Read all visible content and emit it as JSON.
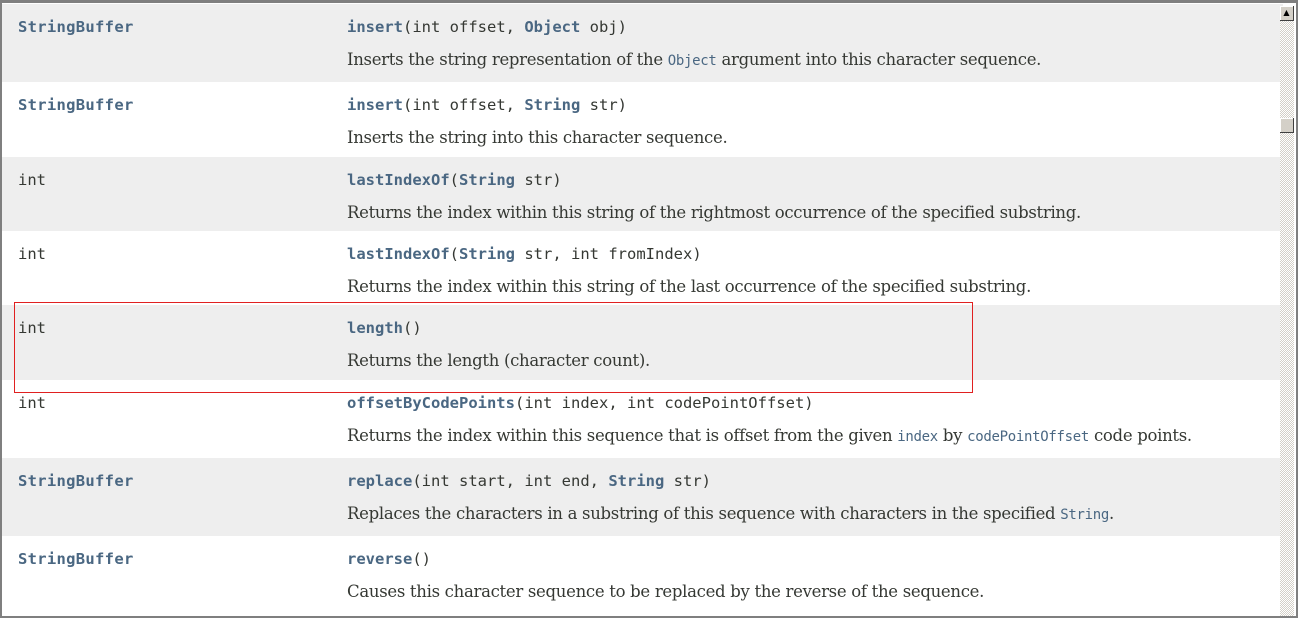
{
  "rows": [
    {
      "type": "StringBuffer",
      "type_link": true,
      "method": "insert",
      "params": [
        [
          "int",
          " offset, "
        ],
        [
          "Object",
          " obj"
        ]
      ],
      "desc": [
        [
          "text",
          "Inserts the string representation of the "
        ],
        [
          "code",
          "Object"
        ],
        [
          "text",
          " argument into this character sequence."
        ]
      ]
    },
    {
      "type": "StringBuffer",
      "type_link": true,
      "method": "insert",
      "params": [
        [
          "int",
          " offset, "
        ],
        [
          "String",
          " str"
        ]
      ],
      "desc": [
        [
          "text",
          "Inserts the string into this character sequence."
        ]
      ]
    },
    {
      "type": "int",
      "type_link": false,
      "method": "lastIndexOf",
      "params": [
        [
          "String",
          " str"
        ]
      ],
      "desc": [
        [
          "text",
          "Returns the index within this string of the rightmost occurrence of the specified substring."
        ]
      ]
    },
    {
      "type": "int",
      "type_link": false,
      "method": "lastIndexOf",
      "params": [
        [
          "String",
          " str, "
        ],
        [
          "int",
          " fromIndex"
        ]
      ],
      "desc": [
        [
          "text",
          "Returns the index within this string of the last occurrence of the specified substring."
        ]
      ]
    },
    {
      "type": "int",
      "type_link": false,
      "method": "length",
      "params": [],
      "desc": [
        [
          "text",
          "Returns the length (character count)."
        ]
      ]
    },
    {
      "type": "int",
      "type_link": false,
      "method": "offsetByCodePoints",
      "params": [
        [
          "int",
          " index, "
        ],
        [
          "int",
          " codePointOffset"
        ]
      ],
      "desc": [
        [
          "text",
          "Returns the index within this sequence that is offset from the given "
        ],
        [
          "code",
          "index"
        ],
        [
          "text",
          " by "
        ],
        [
          "code",
          "codePointOffset"
        ],
        [
          "text",
          " code points."
        ]
      ]
    },
    {
      "type": "StringBuffer",
      "type_link": true,
      "method": "replace",
      "params": [
        [
          "int",
          " start, "
        ],
        [
          "int",
          " end, "
        ],
        [
          "String",
          " str"
        ]
      ],
      "desc": [
        [
          "text",
          "Replaces the characters in a substring of this sequence with characters in the specified "
        ],
        [
          "code",
          "String"
        ],
        [
          "text",
          "."
        ]
      ]
    },
    {
      "type": "StringBuffer",
      "type_link": true,
      "method": "reverse",
      "params": [],
      "desc": [
        [
          "text",
          "Causes this character sequence to be replaced by the reverse of the sequence."
        ]
      ]
    }
  ],
  "highlighted_row": 4,
  "highlight_color": "#e02020",
  "scrollbar": {
    "up_icon": "scroll-up-arrow-icon"
  }
}
